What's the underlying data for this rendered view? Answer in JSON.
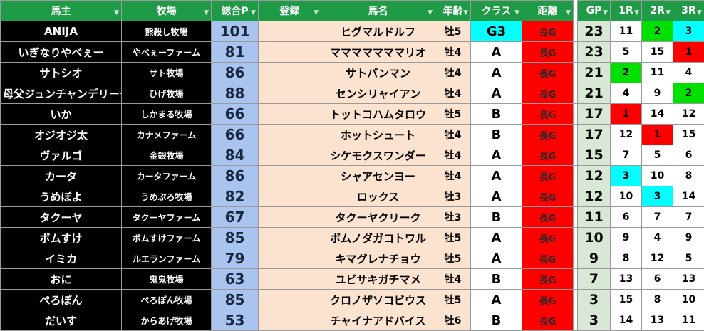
{
  "sheet": {
    "headers": {
      "owner": "馬主",
      "ranch": "牧場",
      "points": "総合P",
      "register": "登録",
      "horse": "馬名",
      "age": "年齢",
      "class": "クラス",
      "distance": "距離",
      "gp": "GP",
      "r1": "1R",
      "r2": "2R",
      "r3": "3R",
      "filter_glyph": "▼"
    },
    "highlight_colors": {
      "cyan": "#00ffff",
      "green": "#00e000",
      "red": "#ff0000"
    },
    "rows": [
      {
        "owner": "ANIJA",
        "ranch": "熊殺し牧場",
        "points": "101",
        "register": "",
        "horse": "ヒグマルドルフ",
        "age": "牡5",
        "class": "G3",
        "distance": "長G",
        "gp": "23",
        "r1": "11",
        "r2": "2",
        "r3": "3",
        "class_hl": "cyan",
        "r1_hl": "",
        "r2_hl": "green",
        "r3_hl": "cyan"
      },
      {
        "owner": "いぎなりやべぇー",
        "ranch": "やべぇーファーム",
        "points": "81",
        "register": "",
        "horse": "マママママママリオ",
        "age": "牡4",
        "class": "A",
        "distance": "長G",
        "gp": "23",
        "r1": "5",
        "r2": "15",
        "r3": "1",
        "class_hl": "",
        "r1_hl": "",
        "r2_hl": "",
        "r3_hl": "red"
      },
      {
        "owner": "サトシオ",
        "ranch": "サト牧場",
        "points": "86",
        "register": "",
        "horse": "サトパンマン",
        "age": "牡4",
        "class": "A",
        "distance": "長G",
        "gp": "21",
        "r1": "2",
        "r2": "11",
        "r3": "4",
        "class_hl": "",
        "r1_hl": "green",
        "r2_hl": "",
        "r3_hl": ""
      },
      {
        "owner": "母父ジュンチャンデリーチ",
        "ranch": "ひげ牧場",
        "points": "88",
        "register": "",
        "horse": "センシリャイアン",
        "age": "牡4",
        "class": "A",
        "distance": "長G",
        "gp": "21",
        "r1": "4",
        "r2": "9",
        "r3": "2",
        "class_hl": "",
        "r1_hl": "",
        "r2_hl": "",
        "r3_hl": "green"
      },
      {
        "owner": "いか",
        "ranch": "しかまる牧場",
        "points": "66",
        "register": "",
        "horse": "トットコハムタロウ",
        "age": "牡5",
        "class": "B",
        "distance": "長G",
        "gp": "17",
        "r1": "1",
        "r2": "14",
        "r3": "12",
        "class_hl": "",
        "r1_hl": "red",
        "r2_hl": "",
        "r3_hl": ""
      },
      {
        "owner": "オジオジ太",
        "ranch": "カナメファーム",
        "points": "66",
        "register": "",
        "horse": "ホットシュート",
        "age": "牡4",
        "class": "B",
        "distance": "長G",
        "gp": "17",
        "r1": "12",
        "r2": "1",
        "r3": "15",
        "class_hl": "",
        "r1_hl": "",
        "r2_hl": "red",
        "r3_hl": ""
      },
      {
        "owner": "ヴァルゴ",
        "ranch": "金銀牧場",
        "points": "84",
        "register": "",
        "horse": "シケモクスワンダー",
        "age": "牡4",
        "class": "A",
        "distance": "長G",
        "gp": "15",
        "r1": "7",
        "r2": "5",
        "r3": "6",
        "class_hl": "",
        "r1_hl": "",
        "r2_hl": "",
        "r3_hl": ""
      },
      {
        "owner": "カータ",
        "ranch": "カータファーム",
        "points": "86",
        "register": "",
        "horse": "シャアセンヨー",
        "age": "牡4",
        "class": "A",
        "distance": "長G",
        "gp": "12",
        "r1": "3",
        "r2": "10",
        "r3": "8",
        "class_hl": "",
        "r1_hl": "cyan",
        "r2_hl": "",
        "r3_hl": ""
      },
      {
        "owner": "うめぼよ",
        "ranch": "うめぶろ牧場",
        "points": "82",
        "register": "",
        "horse": "ロックス",
        "age": "牡3",
        "class": "A",
        "distance": "長G",
        "gp": "12",
        "r1": "10",
        "r2": "3",
        "r3": "14",
        "class_hl": "",
        "r1_hl": "",
        "r2_hl": "cyan",
        "r3_hl": ""
      },
      {
        "owner": "タクーヤ",
        "ranch": "タクーヤファーム",
        "points": "67",
        "register": "",
        "horse": "タクーヤクリーク",
        "age": "牡3",
        "class": "B",
        "distance": "長G",
        "gp": "11",
        "r1": "6",
        "r2": "7",
        "r3": "7",
        "class_hl": "",
        "r1_hl": "",
        "r2_hl": "",
        "r3_hl": ""
      },
      {
        "owner": "ボムすけ",
        "ranch": "ボムすけファーム",
        "points": "85",
        "register": "",
        "horse": "ボムノダガコトワル",
        "age": "牡5",
        "class": "A",
        "distance": "長G",
        "gp": "10",
        "r1": "9",
        "r2": "4",
        "r3": "9",
        "class_hl": "",
        "r1_hl": "",
        "r2_hl": "",
        "r3_hl": ""
      },
      {
        "owner": "イミカ",
        "ranch": "ルエランファーム",
        "points": "79",
        "register": "",
        "horse": "キマグレナチョウ",
        "age": "牡5",
        "class": "A",
        "distance": "長G",
        "gp": "9",
        "r1": "8",
        "r2": "12",
        "r3": "5",
        "class_hl": "",
        "r1_hl": "",
        "r2_hl": "",
        "r3_hl": ""
      },
      {
        "owner": "おに",
        "ranch": "鬼鬼牧場",
        "points": "63",
        "register": "",
        "horse": "ユビサキガチマメ",
        "age": "牡4",
        "class": "B",
        "distance": "長G",
        "gp": "7",
        "r1": "13",
        "r2": "6",
        "r3": "13",
        "class_hl": "",
        "r1_hl": "",
        "r2_hl": "",
        "r3_hl": ""
      },
      {
        "owner": "ぺろぽん",
        "ranch": "ぺろぽん牧場",
        "points": "85",
        "register": "",
        "horse": "クロノザソコビウス",
        "age": "牡5",
        "class": "A",
        "distance": "長G",
        "gp": "3",
        "r1": "15",
        "r2": "8",
        "r3": "10",
        "class_hl": "",
        "r1_hl": "",
        "r2_hl": "",
        "r3_hl": ""
      },
      {
        "owner": "だいす",
        "ranch": "からあげ牧場",
        "points": "53",
        "register": "",
        "horse": "チャイナアドバイス",
        "age": "牡6",
        "class": "B",
        "distance": "長G",
        "gp": "3",
        "r1": "14",
        "r2": "13",
        "r3": "11",
        "class_hl": "",
        "r1_hl": "",
        "r2_hl": "",
        "r3_hl": ""
      }
    ]
  }
}
